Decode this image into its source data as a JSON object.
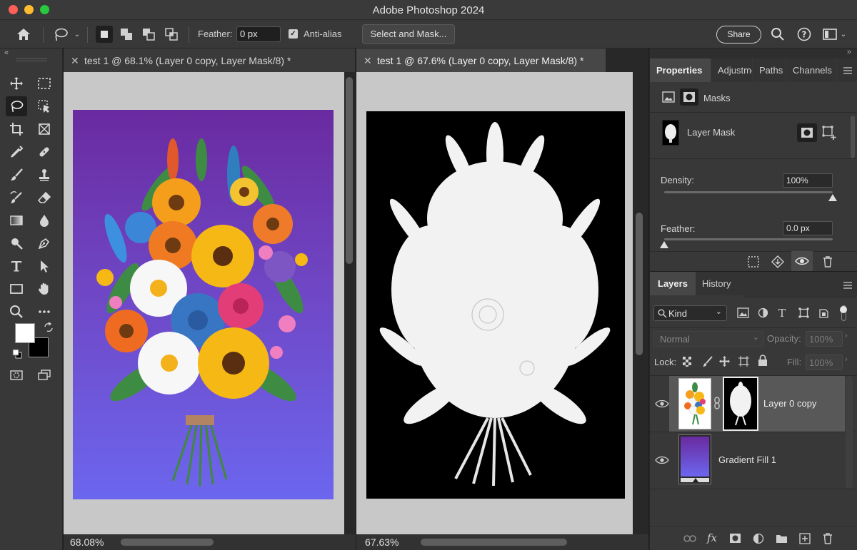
{
  "window": {
    "title": "Adobe Photoshop 2024"
  },
  "options_bar": {
    "feather_label": "Feather:",
    "feather_value": "0 px",
    "anti_alias_label": "Anti-alias",
    "anti_alias_checked": true,
    "select_and_mask_label": "Select and Mask...",
    "share_label": "Share"
  },
  "documents": [
    {
      "tab_title": "test 1 @ 68.1% (Layer 0 copy, Layer Mask/8) *",
      "zoom": "68.08%",
      "active": false
    },
    {
      "tab_title": "test 1 @ 67.6% (Layer 0 copy, Layer Mask/8) *",
      "zoom": "67.63%",
      "active": true
    }
  ],
  "tools": [
    "move-tool",
    "marquee-tool",
    "lasso-tool",
    "object-selection-tool",
    "crop-tool",
    "frame-tool",
    "eyedropper-tool",
    "healing-brush-tool",
    "brush-tool",
    "clone-stamp-tool",
    "history-brush-tool",
    "eraser-tool",
    "gradient-tool",
    "blur-tool",
    "dodge-tool",
    "pen-tool",
    "type-tool",
    "path-selection-tool",
    "rectangle-tool",
    "hand-tool",
    "zoom-tool",
    "more-tools"
  ],
  "colors": {
    "foreground": "#ffffff",
    "background": "#000000",
    "accent": "#474747"
  },
  "properties_panel": {
    "tabs": [
      "Properties",
      "Adjustments",
      "Paths",
      "Channels"
    ],
    "masks_label": "Masks",
    "layer_mask_label": "Layer Mask",
    "density_label": "Density:",
    "density_value": "100%",
    "density_level": 1.0,
    "feather_label": "Feather:",
    "feather_value": "0.0 px",
    "feather_level": 0.0
  },
  "layers_panel": {
    "tabs": [
      "Layers",
      "History"
    ],
    "filter_kind": "Kind",
    "blend_mode": "Normal",
    "opacity_label": "Opacity:",
    "opacity_value": "100%",
    "lock_label": "Lock:",
    "fill_label": "Fill:",
    "fill_value": "100%",
    "layers": [
      {
        "name": "Layer 0 copy",
        "visible": true,
        "selected": true,
        "has_mask": true
      },
      {
        "name": "Gradient Fill 1",
        "visible": true,
        "selected": false,
        "has_mask": false
      }
    ]
  }
}
